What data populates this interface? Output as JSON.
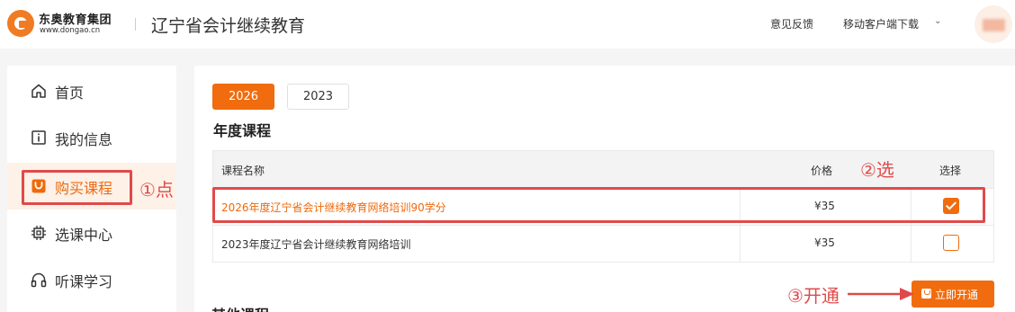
{
  "header": {
    "logo_cn": "东奥教育集团",
    "logo_en": "www.dongao.cn",
    "site_title": "辽宁省会计继续教育",
    "feedback": "意见反馈",
    "download": "移动客户端下载",
    "download_caret": "⌄"
  },
  "sidebar": {
    "items": [
      {
        "label": "首页",
        "icon": "home-icon",
        "active": false
      },
      {
        "label": "我的信息",
        "icon": "info-icon",
        "active": false
      },
      {
        "label": "购买课程",
        "icon": "cart-icon",
        "active": true
      },
      {
        "label": "选课中心",
        "icon": "chip-icon",
        "active": false
      },
      {
        "label": "听课学习",
        "icon": "headphones-icon",
        "active": false
      }
    ]
  },
  "main": {
    "year_tabs": [
      {
        "label": "2026",
        "active": true
      },
      {
        "label": "2023",
        "active": false
      }
    ],
    "section_title": "年度课程",
    "next_section_title": "其他课程",
    "table": {
      "headers": {
        "name": "课程名称",
        "price": "价格",
        "select": "选择"
      },
      "rows": [
        {
          "name": "2026年度辽宁省会计继续教育网络培训90学分",
          "price": "¥35",
          "checked": true,
          "highlight": true
        },
        {
          "name": "2023年度辽宁省会计继续教育网络培训",
          "price": "¥35",
          "checked": false,
          "highlight": false
        }
      ]
    },
    "open_button": "立即开通"
  },
  "annotations": {
    "click": "①点",
    "select": "②选",
    "open": "③开通"
  },
  "colors": {
    "accent": "#f06c0e",
    "annotation": "#e04a4a"
  }
}
